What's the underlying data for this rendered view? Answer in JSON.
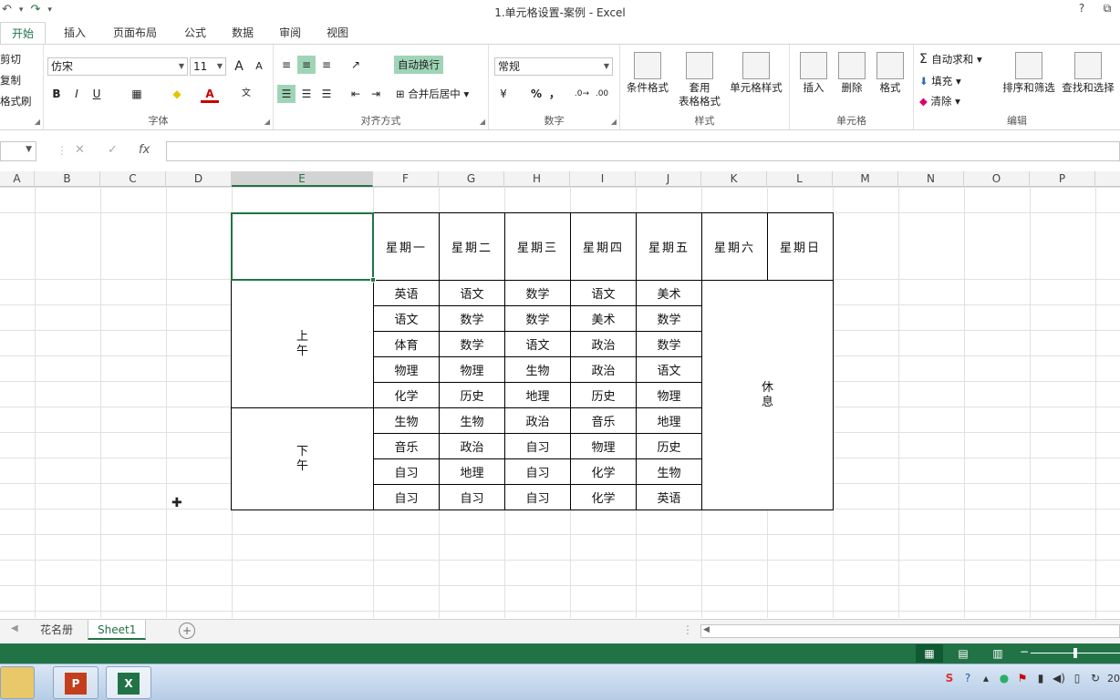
{
  "window": {
    "title": "1.单元格设置-案例 - Excel",
    "help": "?",
    "restore": "⧉"
  },
  "qat": {
    "undo": "↶",
    "redo": "↷",
    "more": "▾"
  },
  "tabs": [
    "开始",
    "插入",
    "页面布局",
    "公式",
    "数据",
    "审阅",
    "视图"
  ],
  "ribbon": {
    "clipboard": {
      "cut": "剪切",
      "copy": "复制",
      "painter": "格式刷"
    },
    "font": {
      "name": "仿宋",
      "size": "11",
      "grow": "A",
      "shrink": "A",
      "bold": "B",
      "italic": "I",
      "underline": "U",
      "label": "字体"
    },
    "align": {
      "wrap": "自动换行",
      "merge": "合并后居中",
      "label": "对齐方式"
    },
    "number": {
      "format": "常规",
      "percent": "%",
      "comma": "，",
      "label": "数字"
    },
    "styles": {
      "cond": "条件格式",
      "table_l1": "套用",
      "table_l2": "表格格式",
      "cell": "单元格样式",
      "label": "样式"
    },
    "cells": {
      "insert": "插入",
      "delete": "删除",
      "format": "格式",
      "label": "单元格"
    },
    "editing": {
      "autosum": "自动求和",
      "fill": "填充",
      "clear": "清除",
      "sort": "排序和筛选",
      "find": "查找和选择",
      "label": "编辑"
    }
  },
  "formula": {
    "fx": "fx",
    "cancel": "✕",
    "enter": "✓",
    "name": ""
  },
  "columns": [
    "A",
    "B",
    "C",
    "D",
    "E",
    "F",
    "G",
    "H",
    "I",
    "J",
    "K",
    "L",
    "M",
    "N",
    "O",
    "P"
  ],
  "timetable": {
    "days": [
      "星期一",
      "星期二",
      "星期三",
      "星期四",
      "星期五",
      "星期六",
      "星期日"
    ],
    "morning": [
      "上",
      "午"
    ],
    "afternoon": [
      "下",
      "午"
    ],
    "rest": [
      "休",
      "息"
    ],
    "rows": [
      [
        "英语",
        "语文",
        "数学",
        "语文",
        "美术"
      ],
      [
        "语文",
        "数学",
        "数学",
        "美术",
        "数学"
      ],
      [
        "体育",
        "数学",
        "语文",
        "政治",
        "数学"
      ],
      [
        "物理",
        "物理",
        "生物",
        "政治",
        "语文"
      ],
      [
        "化学",
        "历史",
        "地理",
        "历史",
        "物理"
      ],
      [
        "生物",
        "生物",
        "政治",
        "音乐",
        "地理"
      ],
      [
        "音乐",
        "政治",
        "自习",
        "物理",
        "历史"
      ],
      [
        "自习",
        "地理",
        "自习",
        "化学",
        "生物"
      ],
      [
        "自习",
        "自习",
        "自习",
        "化学",
        "英语"
      ]
    ]
  },
  "sheets": [
    "花名册",
    "Sheet1"
  ],
  "taskbar": {
    "clock": "20"
  }
}
